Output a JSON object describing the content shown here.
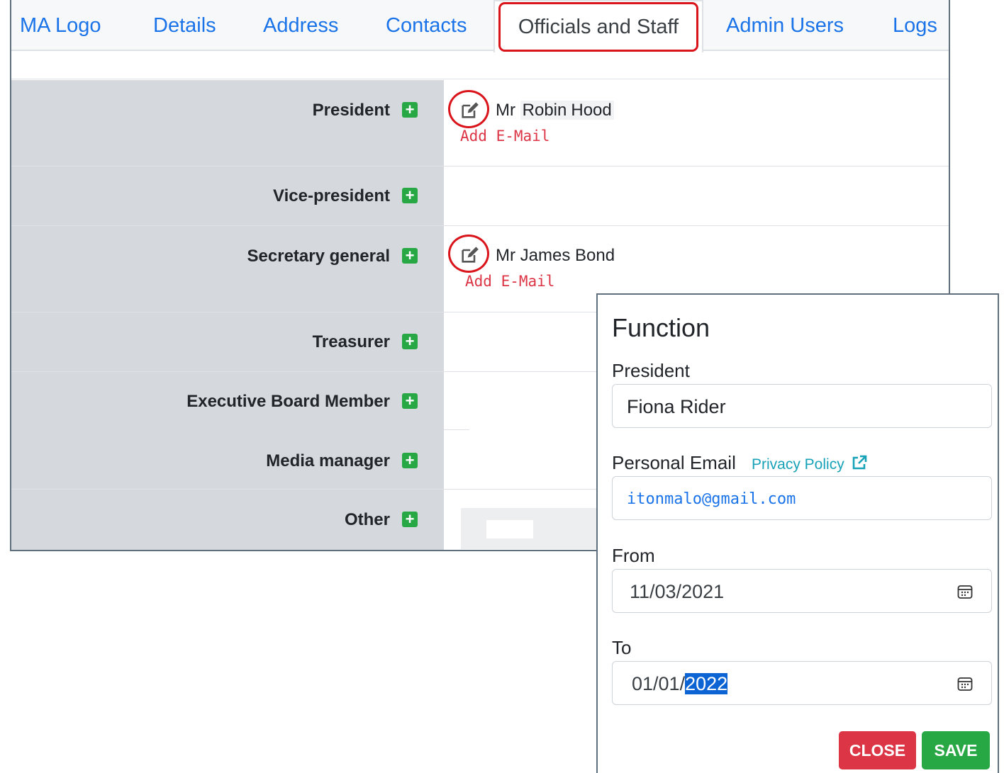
{
  "tabs": [
    {
      "label": "MA Logo"
    },
    {
      "label": "Details"
    },
    {
      "label": "Address"
    },
    {
      "label": "Contacts"
    },
    {
      "label": "Officials and Staff"
    },
    {
      "label": "Admin Users"
    },
    {
      "label": "Logs"
    }
  ],
  "active_tab": "Officials and Staff",
  "functions": [
    {
      "label": "President",
      "person": {
        "title": "Mr",
        "first": "Robin",
        "last": "Hood"
      },
      "add_email": "Add E-Mail"
    },
    {
      "label": "Vice-president"
    },
    {
      "label": "Secretary general",
      "person": {
        "title": "Mr",
        "first": "James",
        "last": "Bond"
      },
      "add_email": "Add E-Mail"
    },
    {
      "label": "Treasurer"
    },
    {
      "label": "Executive Board Member"
    },
    {
      "label": "Media manager"
    },
    {
      "label": "Other"
    }
  ],
  "plus_glyph": "+",
  "modal": {
    "title": "Function",
    "function_label": "President",
    "name_value": "Fiona Rider",
    "email_label": "Personal Email",
    "privacy_link": "Privacy Policy",
    "email_value": "itonmalo@gmail.com",
    "from_label": "From",
    "from_value": "11/03/2021",
    "to_label": "To",
    "to_value_prefix": "01/01/",
    "to_value_selected": "2022",
    "close_label": "CLOSE",
    "save_label": "SAVE"
  },
  "colors": {
    "link": "#1a73e8",
    "highlight": "#d9141b",
    "add_green": "#28a745",
    "danger": "#dc3545",
    "info": "#17a2b8"
  }
}
